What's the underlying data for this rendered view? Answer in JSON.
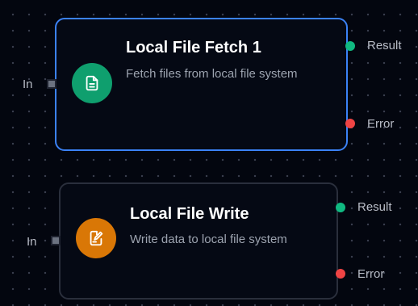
{
  "nodes": [
    {
      "title": "Local File Fetch 1",
      "description": "Fetch files from local file system",
      "icon": "file-icon",
      "icon_color": "#0f9f6e",
      "selected": true,
      "input_label": "In",
      "outputs": {
        "result_label": "Result",
        "error_label": "Error"
      }
    },
    {
      "title": "Local File Write",
      "description": "Write data to local file system",
      "icon": "file-edit-icon",
      "icon_color": "#d97706",
      "selected": false,
      "input_label": "In",
      "outputs": {
        "result_label": "Result",
        "error_label": "Error"
      }
    }
  ],
  "colors": {
    "selected_border": "#3b82f6",
    "result_port": "#10b981",
    "error_port": "#ef4444",
    "background": "#03060f"
  }
}
